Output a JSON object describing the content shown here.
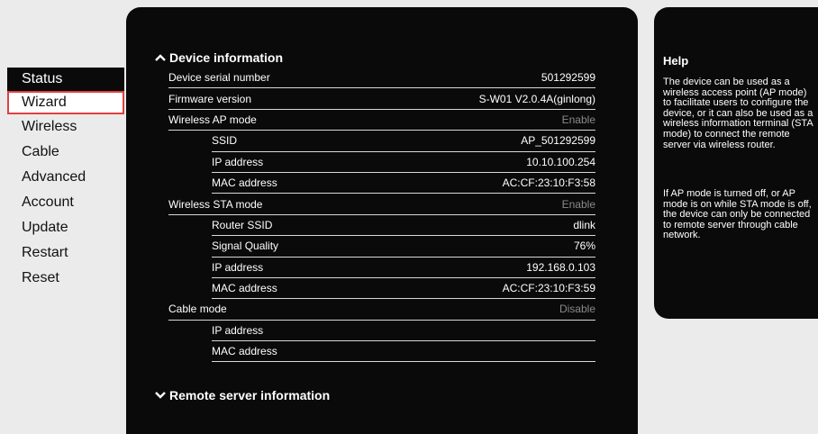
{
  "nav": {
    "items": [
      "Status",
      "Wizard",
      "Wireless",
      "Cable",
      "Advanced",
      "Account",
      "Update",
      "Restart",
      "Reset"
    ],
    "active": "Status",
    "focused": "Wizard"
  },
  "device_section": {
    "title": "Device information",
    "rows": [
      {
        "label": "Device serial number",
        "value": "501292599"
      },
      {
        "label": "Firmware version",
        "value": "S-W01 V2.0.4A(ginlong)"
      },
      {
        "label": "Wireless AP mode",
        "value": "Enable"
      },
      {
        "label": "SSID",
        "value": "AP_501292599"
      },
      {
        "label": "IP address",
        "value": "10.10.100.254"
      },
      {
        "label": "MAC address",
        "value": "AC:CF:23:10:F3:58"
      },
      {
        "label": "Wireless STA mode",
        "value": "Enable"
      },
      {
        "label": "Router SSID",
        "value": "dlink"
      },
      {
        "label": "Signal Quality",
        "value": "76%"
      },
      {
        "label": "IP address",
        "value": "192.168.0.103"
      },
      {
        "label": "MAC address",
        "value": "AC:CF:23:10:F3:59"
      },
      {
        "label": "Cable mode",
        "value": "Disable"
      },
      {
        "label": "IP address",
        "value": ""
      },
      {
        "label": "MAC address",
        "value": ""
      }
    ]
  },
  "remote_section": {
    "title": "Remote server information"
  },
  "help": {
    "title": "Help",
    "paragraph1": "The device can be used as a wireless access point (AP mode) to facilitate users to configure the device, or it can also be used as a wireless information terminal (STA mode) to connect the remote server via wireless router.",
    "paragraph2": "If AP mode is turned off, or AP mode is on while STA mode is off, the device can only be connected to remote server through cable network."
  },
  "colors": {
    "panel": "#0a0a0a",
    "page_bg": "#ebebeb",
    "focus_border": "#e04040",
    "muted_value": "#8a8a8a"
  },
  "icons": [
    "chevron-up-icon",
    "chevron-down-icon"
  ]
}
